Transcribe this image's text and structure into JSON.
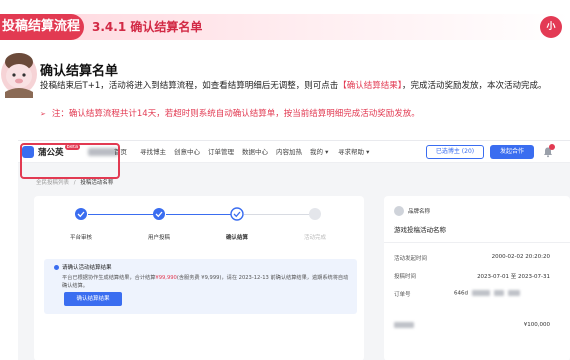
{
  "banner": {
    "section_title": "投稿结算流程",
    "subsection": "3.4.1 确认结算名单",
    "logo_text": "小"
  },
  "intro": {
    "title": "确认结算名单",
    "para_before": "投稿结束后T+1，活动将进入到结算流程，如查看结算明细后无调整，则可点击",
    "para_highlight": "【确认结算结果】",
    "para_after": "，完成活动奖励发放，本次活动完成。",
    "note_arrow": "➢",
    "note": "注：确认结算流程共计14天，若超时则系统自动确认结算单，按当前结算明细完成活动奖励发放。"
  },
  "app": {
    "brand_name": "蒲公英",
    "brand_badge": "Beta",
    "nav_items": [
      "首页",
      "寻找博主",
      "创意中心",
      "订单管理",
      "数据中心",
      "内容加热",
      "我的 ▾",
      "寻求帮助 ▾"
    ],
    "balance_button": "已选博主 (20)",
    "create_button": "发起合作",
    "notifications_badge": "",
    "breadcrumb_parent": "全民投稿列表",
    "breadcrumb_sep": "/",
    "breadcrumb_current": "投稿活动名称",
    "steps": [
      {
        "label": "平台审核",
        "state": "done"
      },
      {
        "label": "用户投稿",
        "state": "done"
      },
      {
        "label": "确认结算",
        "state": "active"
      },
      {
        "label": "活动完成",
        "state": "todo"
      }
    ],
    "notice": {
      "title": "请确认活动结算结果",
      "text_before": "平台已根据协作生成结算结果，合计结算",
      "amount": "¥99,990",
      "text_after": "(含服务费 ¥9,999)，请在 2023-12-13 前确认结算结果，逾期系统将自动确认结算。",
      "button": "确认结算结果"
    },
    "side": {
      "brand_label": "品牌名称",
      "activity_name": "游戏投稿活动名称",
      "rows": [
        {
          "key": "活动发起时间",
          "value": "2000-02-02 20:20:20"
        },
        {
          "key": "投稿时间",
          "value": "2023-07-01 至 2023-07-31"
        },
        {
          "key": "订单号",
          "value": "646d"
        }
      ],
      "bottom_value": "¥100,000"
    }
  },
  "colors": {
    "accent_red": "#e23a52",
    "accent_blue": "#3a6df0"
  }
}
